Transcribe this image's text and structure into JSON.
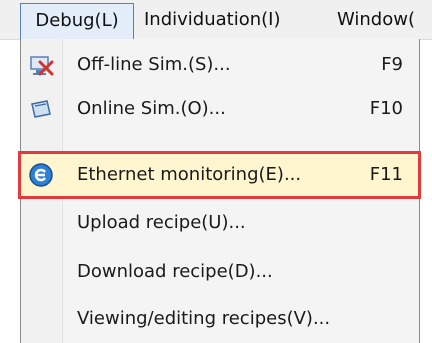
{
  "menubar": {
    "items": [
      {
        "label": "Debug(L)"
      },
      {
        "label": "Individuation(I)"
      },
      {
        "label": "Window("
      }
    ]
  },
  "debug_menu": {
    "items": [
      {
        "label": "Off-line Sim.(S)...",
        "shortcut": "F9",
        "icon": "offline-sim-icon"
      },
      {
        "label": "Online Sim.(O)...",
        "shortcut": "F10",
        "icon": "online-sim-icon"
      },
      {
        "label": "Ethernet monitoring(E)...",
        "shortcut": "F11",
        "icon": "ethernet-monitoring-icon",
        "highlighted": true
      },
      {
        "label": "Upload recipe(U)...",
        "shortcut": ""
      },
      {
        "label": "Download recipe(D)...",
        "shortcut": ""
      },
      {
        "label": "Viewing/editing recipes(V)...",
        "shortcut": ""
      }
    ]
  },
  "colors": {
    "highlight_border": "#e03c3c",
    "active_menu_bg": "#e4eefb",
    "active_menu_border": "#5e7fb4"
  }
}
